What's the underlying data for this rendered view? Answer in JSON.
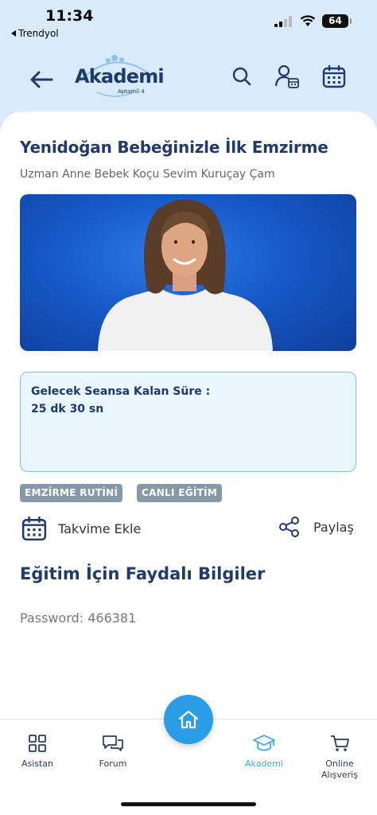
{
  "status_bar": {
    "time": "11:34",
    "back_app": "Trendyol",
    "battery": "64"
  },
  "header": {
    "logo_text": "Akademi",
    "logo_sub": "Aptamil 4"
  },
  "content": {
    "title": "Yenidoğan Bebeğinizle İlk Emzirme",
    "subtitle": "Uzman Anne Bebek Koçu Sevim Kuruçay Çam",
    "timer": {
      "label": "Gelecek Seansa Kalan Süre :",
      "value": "25 dk 30 sn"
    },
    "tags": [
      "EMZİRME RUTİNİ",
      "CANLI EĞİTİM"
    ],
    "calendar_action": "Takvime Ekle",
    "share_action": "Paylaş",
    "section_title": "Eğitim İçin Faydalı Bilgiler",
    "password": "Password: 466381"
  },
  "nav": {
    "items": [
      {
        "label": "Asistan",
        "icon": "grid-icon"
      },
      {
        "label": "Forum",
        "icon": "chat-icon"
      },
      {
        "label": "Akademi",
        "icon": "graduation-cap-icon",
        "active": true
      },
      {
        "label": "Online Alışveriş",
        "icon": "cart-icon"
      }
    ],
    "home_icon": "home-icon"
  },
  "colors": {
    "primary": "#1e3a6e",
    "accent": "#2b9ce6",
    "header_bg": "#d9ebfa",
    "tag_bg": "#8798a8"
  }
}
